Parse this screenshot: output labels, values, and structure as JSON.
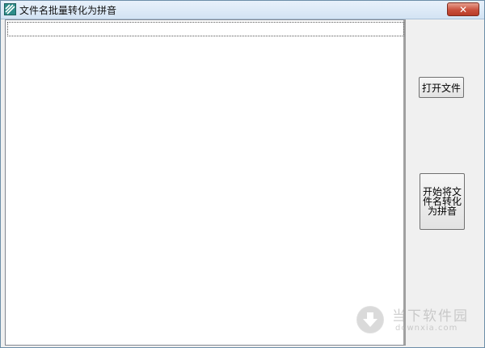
{
  "window": {
    "title": "文件名批量转化为拼音",
    "close_glyph": "✕",
    "icon": "app-icon"
  },
  "buttons": {
    "open_file": "打开文件",
    "convert": "开始将文件名转化为拼音"
  },
  "watermark": {
    "brand": "当下软件园",
    "domain": "downxia.com",
    "icon": "download-arrow-icon"
  },
  "colors": {
    "titlebar": "#dbe8f6",
    "close_button": "#c9503c",
    "background": "#f0f0f0"
  }
}
